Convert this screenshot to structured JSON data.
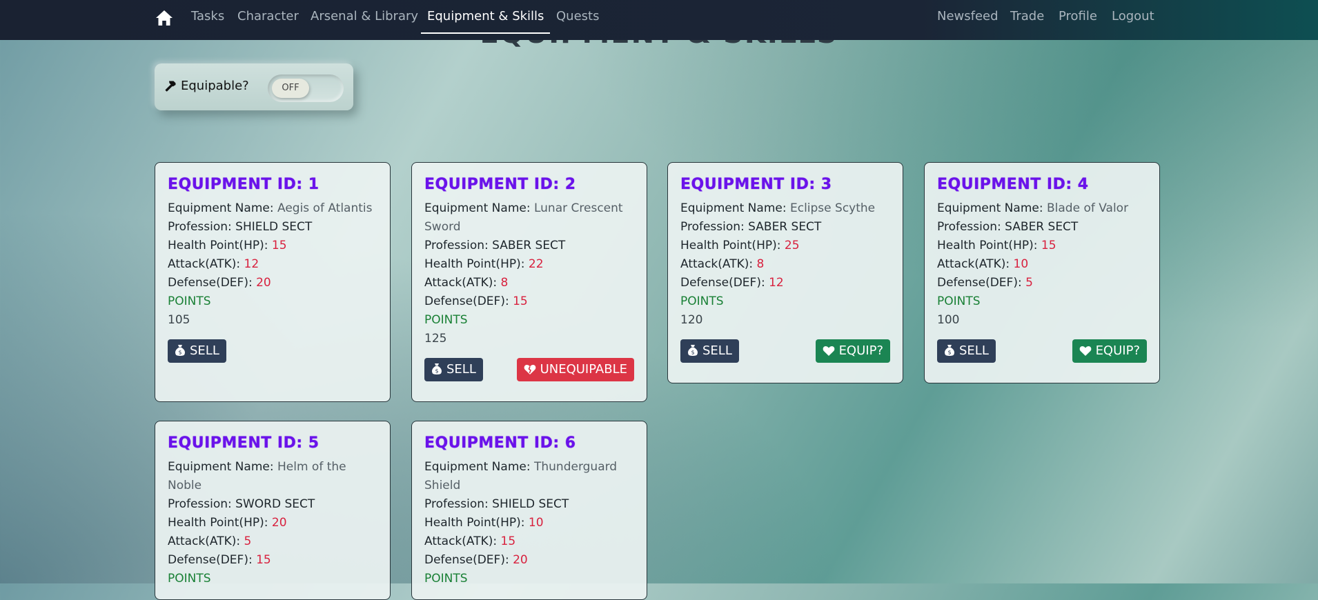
{
  "nav": {
    "home_icon": "home-icon",
    "links": [
      "Tasks",
      "Character",
      "Arsenal & Library",
      "Equipment & Skills",
      "Quests"
    ],
    "right_links": [
      "Newsfeed",
      "Trade",
      "Profile",
      "Logout"
    ],
    "active": "Equipment & Skills"
  },
  "page": {
    "heading": "EQUIPMENT & SKILLS"
  },
  "filter": {
    "icon": "hammer-icon",
    "label": "Equipable?",
    "toggle_state": "OFF"
  },
  "labels": {
    "name": "Equipment Name:",
    "profession": "Profession:",
    "hp": "Health Point(HP):",
    "atk": "Attack(ATK):",
    "def": "Defense(DEF):",
    "points": "POINTS",
    "sell": "SELL",
    "equip": "EQUIP?",
    "unequipable": "UNEQUIPABLE"
  },
  "colors": {
    "title": "#6a12ea",
    "stat_value": "#d8213e",
    "points_label": "#198035",
    "sell_button": "#2f3f58",
    "equip_button": "#1b8553",
    "unequip_button": "#dc3545"
  },
  "cards": [
    {
      "title": "EQUIPMENT ID: 1",
      "name": "Aegis of Atlantis",
      "profession": "SHIELD SECT",
      "hp": "15",
      "atk": "12",
      "def": "20",
      "points": "105",
      "action": "none"
    },
    {
      "title": "EQUIPMENT ID: 2",
      "name": "Lunar Crescent Sword",
      "profession": "SABER SECT",
      "hp": "22",
      "atk": "8",
      "def": "15",
      "points": "125",
      "action": "unequipable"
    },
    {
      "title": "EQUIPMENT ID: 3",
      "name": "Eclipse Scythe",
      "profession": "SABER SECT",
      "hp": "25",
      "atk": "8",
      "def": "12",
      "points": "120",
      "action": "equip"
    },
    {
      "title": "EQUIPMENT ID: 4",
      "name": "Blade of Valor",
      "profession": "SABER SECT",
      "hp": "15",
      "atk": "10",
      "def": "5",
      "points": "100",
      "action": "equip"
    },
    {
      "title": "EQUIPMENT ID: 5",
      "name": "Helm of the Noble",
      "profession": "SWORD SECT",
      "hp": "20",
      "atk": "5",
      "def": "15",
      "points": "",
      "action": "none"
    },
    {
      "title": "EQUIPMENT ID: 6",
      "name": "Thunderguard Shield",
      "profession": "SHIELD SECT",
      "hp": "10",
      "atk": "15",
      "def": "20",
      "points": "",
      "action": "none"
    }
  ]
}
